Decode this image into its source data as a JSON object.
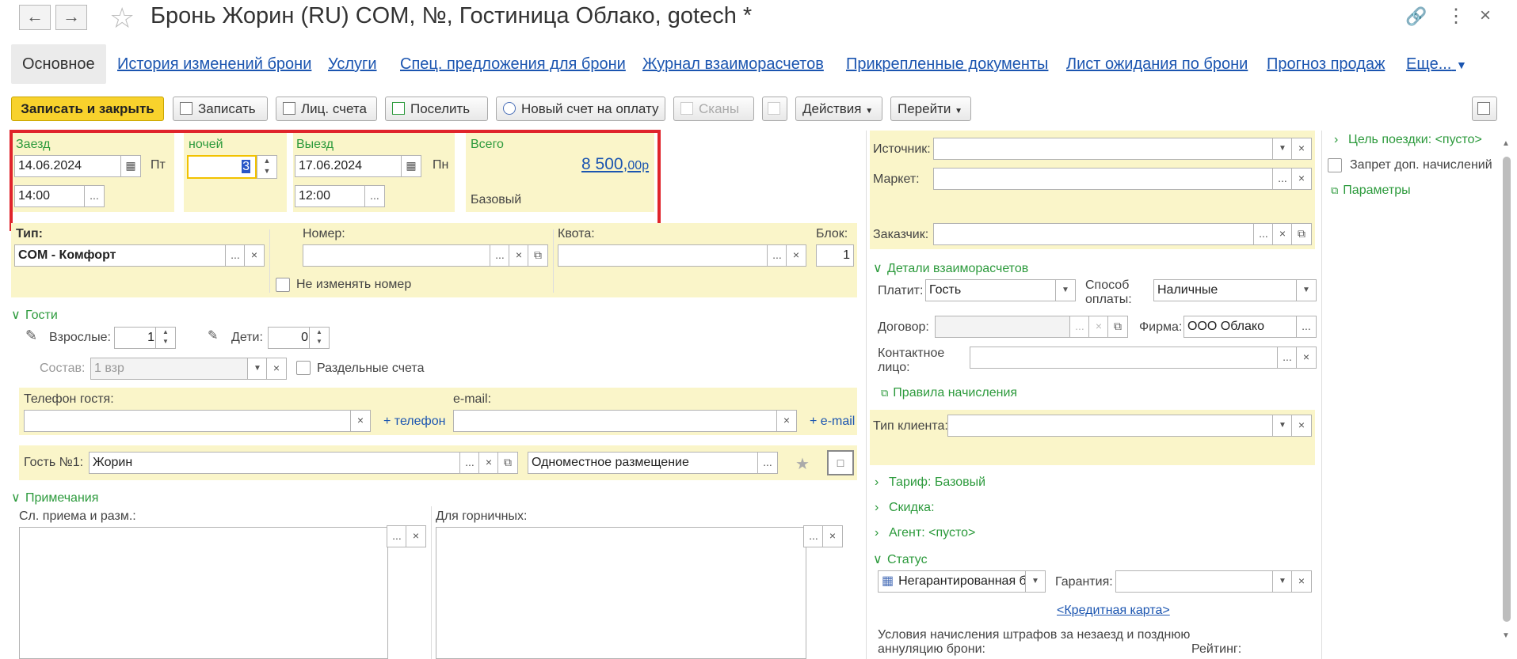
{
  "window": {
    "title": "Бронь Жорин (RU) COM, №, Гостиница Облако, gotech *"
  },
  "tabs": [
    "Основное",
    "История изменений брони",
    "Услуги",
    "Спец. предложения для брони",
    "Журнал взаиморасчетов",
    "Прикрепленные документы",
    "Лист ожидания по брони",
    "Прогноз продаж",
    "Еще..."
  ],
  "toolbar": {
    "save_close": "Записать и закрыть",
    "save": "Записать",
    "accounts": "Лиц. счета",
    "checkin": "Поселить",
    "new_invoice": "Новый счет на оплату",
    "scans": "Сканы",
    "actions": "Действия",
    "goto": "Перейти"
  },
  "stay": {
    "checkin_label": "Заезд",
    "checkin_date": "14.06.2024",
    "checkin_day": "Пт",
    "checkin_time": "14:00",
    "nights_label": "ночей",
    "nights": "3",
    "checkout_label": "Выезд",
    "checkout_date": "17.06.2024",
    "checkout_day": "Пн",
    "checkout_time": "12:00",
    "total_label": "Всего",
    "total_main": "8 500,",
    "total_cents": "00р",
    "rate_label": "Базовый"
  },
  "room": {
    "type_label": "Тип:",
    "type_value": "COM - Комфорт",
    "number_label": "Номер:",
    "number_value": "",
    "quota_label": "Квота:",
    "quota_value": "",
    "block_label": "Блок:",
    "block_value": "1",
    "keep_number": "Не изменять номер"
  },
  "guests": {
    "section": "Гости",
    "adults_label": "Взрослые:",
    "adults": "1",
    "children_label": "Дети:",
    "children": "0",
    "composition_label": "Состав:",
    "composition": "1 взр",
    "separate": "Раздельные счета",
    "phone_label": "Телефон гостя:",
    "add_phone": "+ телефон",
    "email_label": "e-mail:",
    "add_email": "+ e-mail",
    "guest_label": "Гость №1:",
    "guest_name": "Жорин",
    "accommodation": "Одноместное размещение"
  },
  "notes": {
    "section": "Примечания",
    "reception_label": "Сл. приема и разм.:",
    "housekeeping_label": "Для горничных:"
  },
  "right": {
    "source_label": "Источник:",
    "market_label": "Маркет:",
    "customer_label": "Заказчик:",
    "settlement_section": "Детали взаиморасчетов",
    "payer_label": "Платит:",
    "payer": "Гость",
    "pay_method_label": "Способ оплаты:",
    "pay_method": "Наличные",
    "contract_label": "Договор:",
    "firm_label": "Фирма:",
    "firm": "ООО Облако",
    "contact_label": "Контактное лицо:",
    "charge_rules": "Правила начисления",
    "client_type_label": "Тип клиента:",
    "tariff": "Тариф: Базовый",
    "discount": "Скидка:",
    "agent": "Агент: <пусто>",
    "status_section": "Статус",
    "status_value": "Негарантированная бронь",
    "guarantee_label": "Гарантия:",
    "credit_card": "<Кредитная карта>",
    "penalty_text": "Условия начисления штрафов за незаезд и позднюю аннуляцию брони:",
    "rating_label": "Рейтинг:"
  },
  "side": {
    "trip_purpose": "Цель поездки: <пусто>",
    "no_extra": "Запрет доп. начислений",
    "params": "Параметры"
  }
}
